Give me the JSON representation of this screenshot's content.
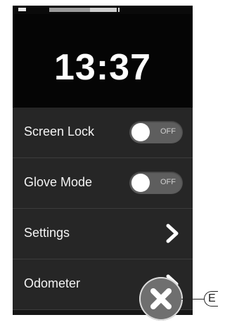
{
  "status_bar": {
    "progress_fraction": 0.6
  },
  "clock": {
    "time": "13:37"
  },
  "menu": {
    "items": [
      {
        "label": "Screen Lock",
        "control": "toggle",
        "state": "OFF"
      },
      {
        "label": "Glove Mode",
        "control": "toggle",
        "state": "OFF"
      },
      {
        "label": "Settings",
        "control": "chevron"
      },
      {
        "label": "Odometer",
        "control": "chevron"
      }
    ]
  },
  "close_button": {
    "icon": "close-icon"
  },
  "callout": {
    "letter": "E"
  },
  "colors": {
    "clock_background": "#050505",
    "menu_background": "#262626",
    "toggle_background": "#5e5e5e",
    "text": "#f4f4f4"
  }
}
